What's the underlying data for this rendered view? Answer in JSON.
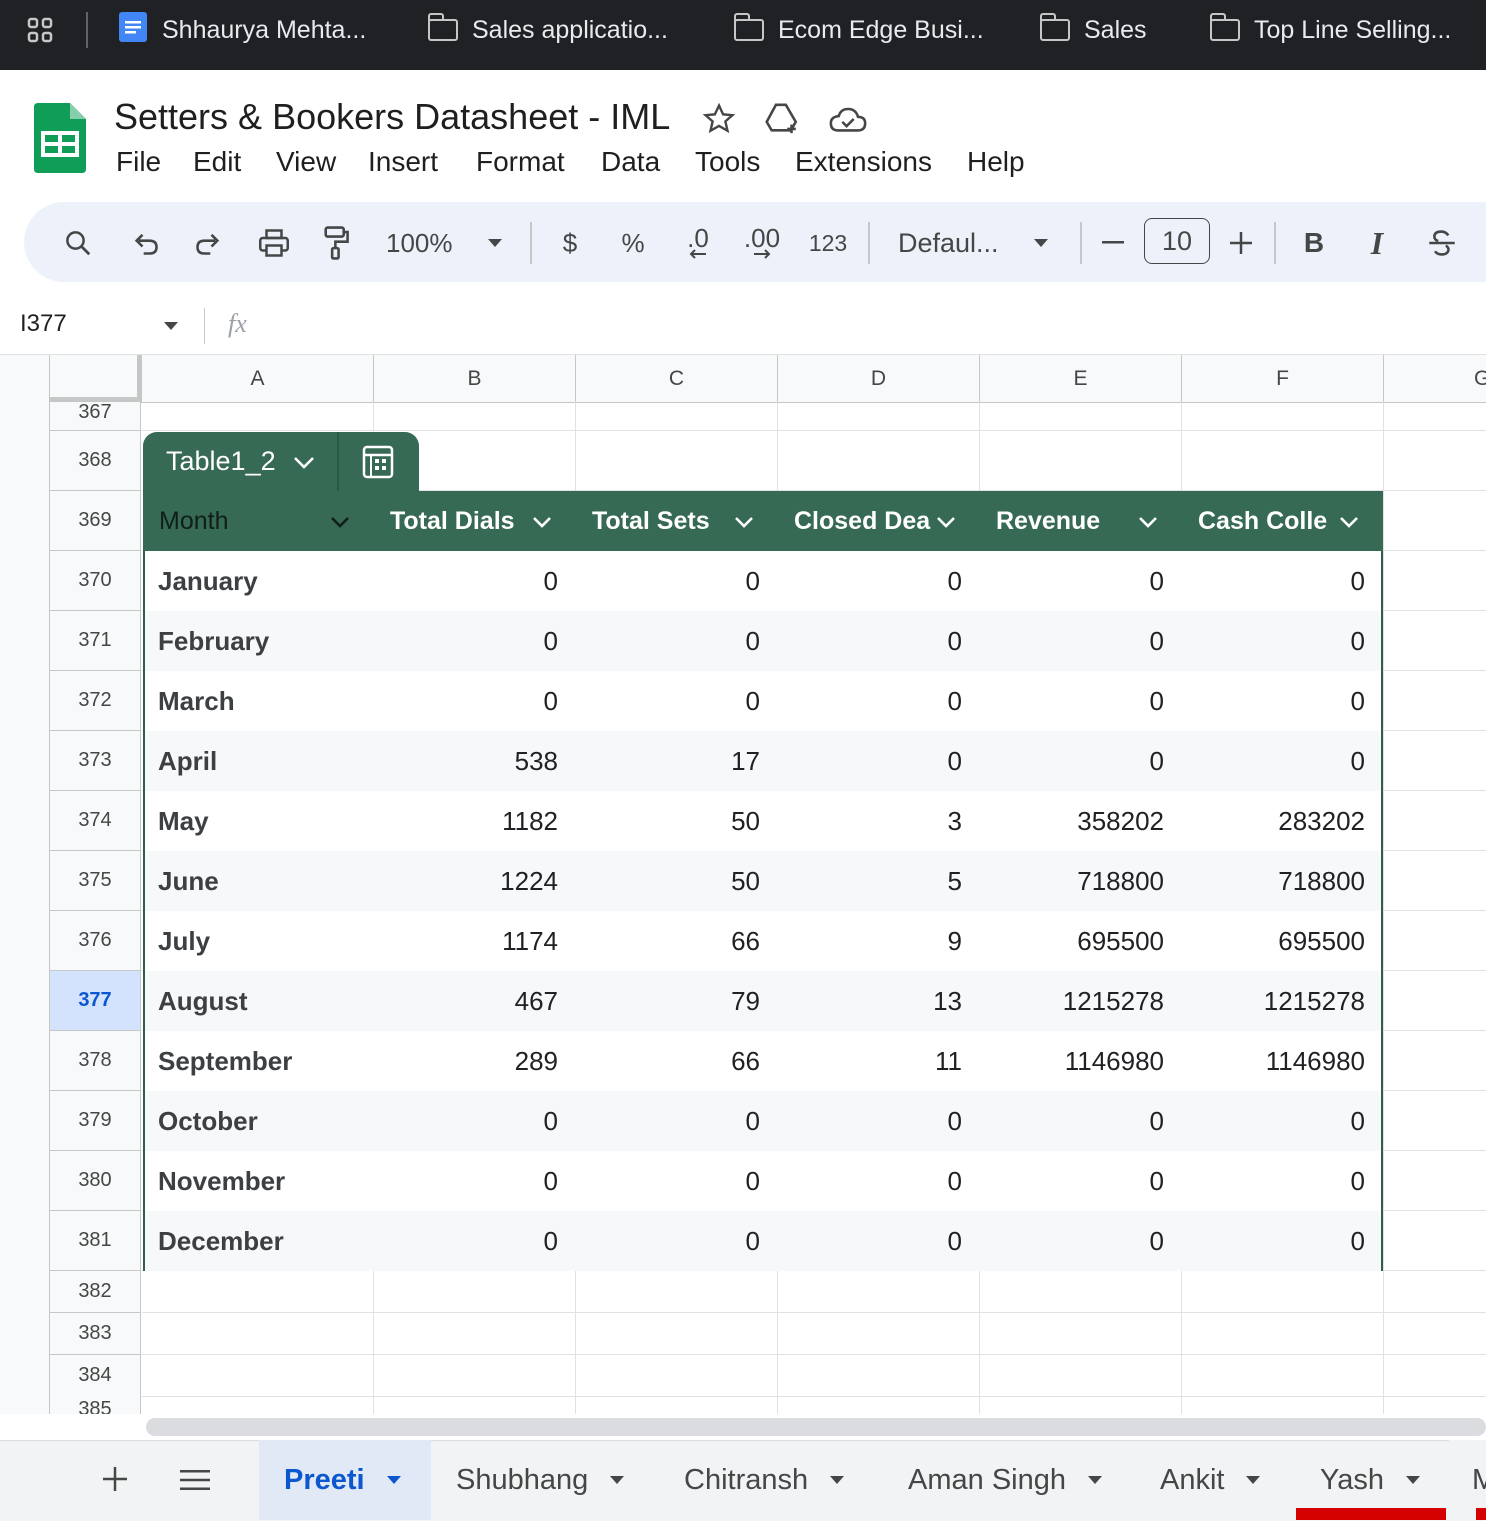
{
  "bookmarks": [
    {
      "label": "Shhaurya Mehta...",
      "icon": "docs-icon"
    },
    {
      "label": "Sales applicatio...",
      "icon": "folder-icon"
    },
    {
      "label": "Ecom Edge Busi...",
      "icon": "folder-icon"
    },
    {
      "label": "Sales",
      "icon": "folder-icon"
    },
    {
      "label": "Top Line Selling...",
      "icon": "folder-icon"
    }
  ],
  "document": {
    "title": "Setters & Bookers Datasheet - IML"
  },
  "menu": [
    "File",
    "Edit",
    "View",
    "Insert",
    "Format",
    "Data",
    "Tools",
    "Extensions",
    "Help"
  ],
  "toolbar": {
    "zoom": "100%",
    "currency": "$",
    "percent": "%",
    "decrease_decimal": ".0",
    "increase_decimal": ".00",
    "number_format": "123",
    "font": "Defaul...",
    "font_size": "10",
    "bold": "B",
    "italic": "I"
  },
  "formula_bar": {
    "cell_ref": "I377",
    "fx": "fx",
    "value": ""
  },
  "columns": [
    "A",
    "B",
    "C",
    "D",
    "E",
    "F",
    "G"
  ],
  "rows": {
    "top_partial": "367",
    "numbers": [
      "368",
      "369",
      "370",
      "371",
      "372",
      "373",
      "374",
      "375",
      "376",
      "377",
      "378",
      "379",
      "380",
      "381",
      "382",
      "383",
      "384"
    ],
    "bottom_partial": "385",
    "selected": "377"
  },
  "table": {
    "name": "Table1_2",
    "header_color": "#376a54",
    "headers": [
      "Month",
      "Total Dials",
      "Total Sets",
      "Closed Dea",
      "Revenue",
      "Cash Colle"
    ],
    "rows": [
      [
        "January",
        "0",
        "0",
        "0",
        "0",
        "0"
      ],
      [
        "February",
        "0",
        "0",
        "0",
        "0",
        "0"
      ],
      [
        "March",
        "0",
        "0",
        "0",
        "0",
        "0"
      ],
      [
        "April",
        "538",
        "17",
        "0",
        "0",
        "0"
      ],
      [
        "May",
        "1182",
        "50",
        "3",
        "358202",
        "283202"
      ],
      [
        "June",
        "1224",
        "50",
        "5",
        "718800",
        "718800"
      ],
      [
        "July",
        "1174",
        "66",
        "9",
        "695500",
        "695500"
      ],
      [
        "August",
        "467",
        "79",
        "13",
        "1215278",
        "1215278"
      ],
      [
        "September",
        "289",
        "66",
        "11",
        "1146980",
        "1146980"
      ],
      [
        "October",
        "0",
        "0",
        "0",
        "0",
        "0"
      ],
      [
        "November",
        "0",
        "0",
        "0",
        "0",
        "0"
      ],
      [
        "December",
        "0",
        "0",
        "0",
        "0",
        "0"
      ]
    ]
  },
  "sheets": {
    "active": "Preeti",
    "tabs": [
      "Preeti",
      "Shubhang",
      "Chitransh",
      "Aman Singh",
      "Ankit",
      "Yash",
      "M"
    ],
    "active_color": "#0b57d0",
    "yash_underline_color": "#d50000"
  }
}
